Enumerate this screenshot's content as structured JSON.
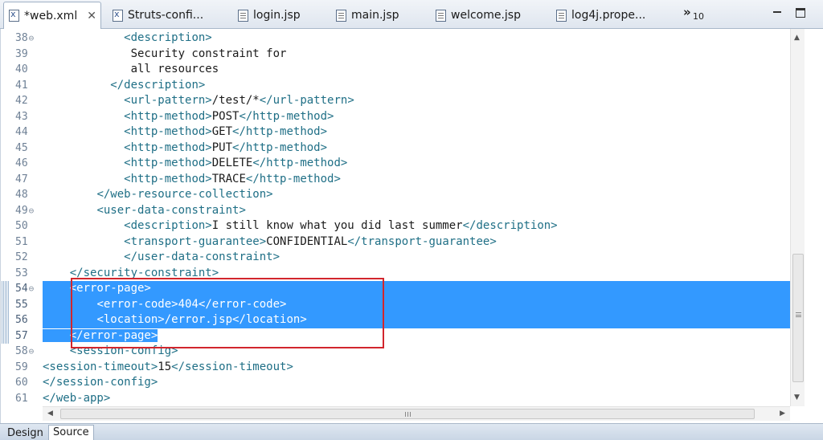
{
  "tabs": [
    {
      "label": "*web.xml",
      "icon": "xml-file-icon",
      "active": true,
      "closable": true
    },
    {
      "label": "Struts-confi...",
      "icon": "xml-file-icon",
      "active": false
    },
    {
      "label": "login.jsp",
      "icon": "jsp-file-icon",
      "active": false
    },
    {
      "label": "main.jsp",
      "icon": "jsp-file-icon",
      "active": false
    },
    {
      "label": "welcome.jsp",
      "icon": "jsp-file-icon",
      "active": false
    },
    {
      "label": "log4j.prope...",
      "icon": "properties-file-icon",
      "active": false
    }
  ],
  "overflow": {
    "chevron": "»",
    "count": "10"
  },
  "editor": {
    "lines": [
      {
        "n": "38",
        "fold": true,
        "text": "            <description>"
      },
      {
        "n": "39",
        "text": "             Security constraint for"
      },
      {
        "n": "40",
        "text": "             all resources"
      },
      {
        "n": "41",
        "text": "          </description>"
      },
      {
        "n": "42",
        "text": "            <url-pattern>/test/*</url-pattern>"
      },
      {
        "n": "43",
        "text": "            <http-method>POST</http-method>"
      },
      {
        "n": "44",
        "text": "            <http-method>GET</http-method>"
      },
      {
        "n": "45",
        "text": "            <http-method>PUT</http-method>"
      },
      {
        "n": "46",
        "text": "            <http-method>DELETE</http-method>"
      },
      {
        "n": "47",
        "text": "            <http-method>TRACE</http-method>"
      },
      {
        "n": "48",
        "text": "        </web-resource-collection>"
      },
      {
        "n": "49",
        "fold": true,
        "text": "        <user-data-constraint>"
      },
      {
        "n": "50",
        "text": "            <description>I still know what you did last summer</description>"
      },
      {
        "n": "51",
        "text": "            <transport-guarantee>CONFIDENTIAL</transport-guarantee>"
      },
      {
        "n": "52",
        "text": "            </user-data-constraint>"
      },
      {
        "n": "53",
        "text": "    </security-constraint>"
      },
      {
        "n": "54",
        "fold": true,
        "selected": true,
        "text": "    <error-page>"
      },
      {
        "n": "55",
        "selected": true,
        "text": "        <error-code>404</error-code>"
      },
      {
        "n": "56",
        "selected": true,
        "text": "        <location>/error.jsp</location>"
      },
      {
        "n": "57",
        "selected": true,
        "text": "    </error-page>"
      },
      {
        "n": "58",
        "fold": true,
        "text": "    <session-config>"
      },
      {
        "n": "59",
        "text": "<session-timeout>15</session-timeout>"
      },
      {
        "n": "60",
        "text": "</session-config>"
      },
      {
        "n": "61",
        "text": "</web-app>"
      }
    ]
  },
  "bottom_tabs": [
    {
      "label": "Design",
      "active": false
    },
    {
      "label": "Source",
      "active": true
    }
  ],
  "colors": {
    "selection": "#3399ff",
    "tag": "#1f6f86",
    "highlight_box": "#d2262d"
  }
}
